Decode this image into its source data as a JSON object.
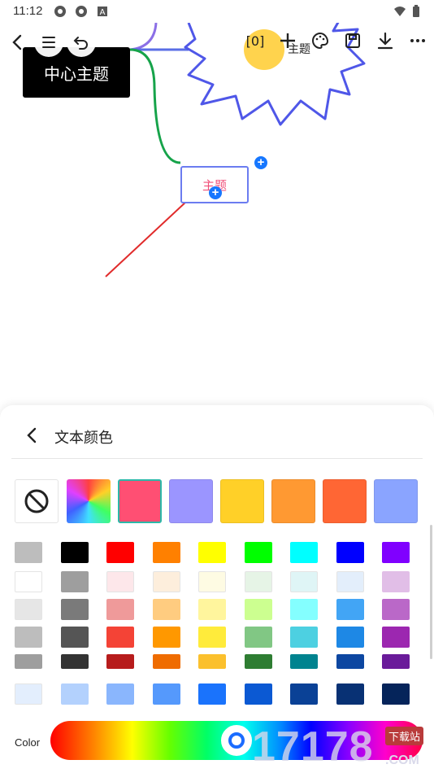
{
  "status_bar": {
    "time": "11:12"
  },
  "canvas": {
    "root_node_label": "中心主题",
    "topic_node_label": "主题",
    "side_node_label": "主题"
  },
  "toolbar": {
    "icons": [
      "back-icon",
      "outline-icon",
      "undo-icon",
      "formula-icon",
      "add-icon",
      "palette-icon",
      "save-icon",
      "download-icon",
      "more-icon"
    ]
  },
  "sheet": {
    "title": "文本颜色",
    "presets": [
      "#ff4f73",
      "#9b95ff",
      "#ffd028",
      "#ff9932",
      "#ff6634",
      "#8aa4ff"
    ],
    "palette_rows": [
      [
        "#bdbdbd",
        "#000000",
        "#ff0000",
        "#ff8000",
        "#ffff00",
        "#00ff00",
        "#00ffff",
        "#0000ff",
        "#8000ff"
      ],
      [
        "#ffffff",
        "#9e9e9e",
        "#fde7ea",
        "#fdeedc",
        "#fefbe3",
        "#e6f4e6",
        "#dff5f6",
        "#e3eefb",
        "#e1bee7"
      ],
      [
        "#e6e6e6",
        "#7a7a7a",
        "#ef9a9a",
        "#ffcc80",
        "#fff59d",
        "#ccff90",
        "#84ffff",
        "#42a5f5",
        "#ba68c8"
      ],
      [
        "#bdbdbd",
        "#555555",
        "#f44336",
        "#ff9800",
        "#ffeb3b",
        "#81c784",
        "#4dd0e1",
        "#1e88e5",
        "#9c27b0"
      ],
      [
        "#9e9e9e",
        "#333333",
        "#b71c1c",
        "#ef6c00",
        "#fbc02d",
        "#2e7d32",
        "#00838f",
        "#0d47a1",
        "#6a1b9a"
      ],
      [
        "#e3eefd",
        "#b3d1fd",
        "#8ab6fd",
        "#5599fc",
        "#1a73fc",
        "#0b59d3",
        "#0a4196",
        "#083174",
        "#05245a"
      ]
    ],
    "color_label": "Color",
    "hue_value": "0.49"
  },
  "watermark": {
    "text": "17178",
    "sub": ".COM",
    "badge": "下载站"
  }
}
